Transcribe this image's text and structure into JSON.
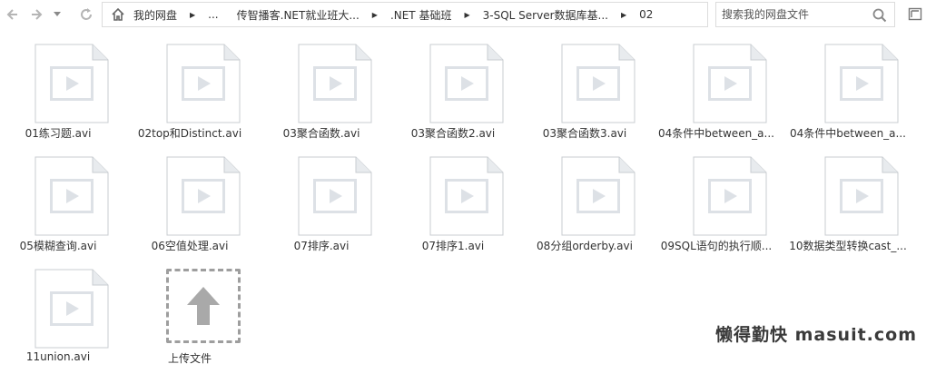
{
  "toolbar": {
    "back_icon": "arrow-left-icon",
    "forward_icon": "arrow-right-icon",
    "dropdown_icon": "chevron-down-icon",
    "refresh_icon": "refresh-icon"
  },
  "breadcrumb": {
    "home_icon": "home-icon",
    "items": [
      "我的网盘",
      "...",
      "传智播客.NET就业班大...",
      ".NET 基础班",
      "3-SQL Server数据库基...",
      "02"
    ]
  },
  "search": {
    "placeholder": "搜索我的网盘文件",
    "icon": "search-icon"
  },
  "expand_icon": "expand-window-icon",
  "files": [
    {
      "name": "01练习题.avi",
      "icon": "video-file-icon"
    },
    {
      "name": "02top和Distinct.avi",
      "icon": "video-file-icon"
    },
    {
      "name": "03聚合函数.avi",
      "icon": "video-file-icon"
    },
    {
      "name": "03聚合函数2.avi",
      "icon": "video-file-icon"
    },
    {
      "name": "03聚合函数3.avi",
      "icon": "video-file-icon"
    },
    {
      "name": "04条件中between_a...",
      "icon": "video-file-icon"
    },
    {
      "name": "04条件中between_a...",
      "icon": "video-file-icon"
    },
    {
      "name": "05模糊查询.avi",
      "icon": "video-file-icon"
    },
    {
      "name": "06空值处理.avi",
      "icon": "video-file-icon"
    },
    {
      "name": "07排序.avi",
      "icon": "video-file-icon"
    },
    {
      "name": "07排序1.avi",
      "icon": "video-file-icon"
    },
    {
      "name": "08分组orderby.avi",
      "icon": "video-file-icon"
    },
    {
      "name": "09SQL语句的执行顺...",
      "icon": "video-file-icon"
    },
    {
      "name": "10数据类型转换cast_...",
      "icon": "video-file-icon"
    },
    {
      "name": "11union.avi",
      "icon": "video-file-icon"
    }
  ],
  "upload": {
    "label": "上传文件",
    "icon": "upload-arrow-icon"
  },
  "watermark": "懒得勤快 masuit.com",
  "colors": {
    "icon_gray": "#dde1e6",
    "icon_border": "#c8ccd1",
    "text": "#333333"
  }
}
